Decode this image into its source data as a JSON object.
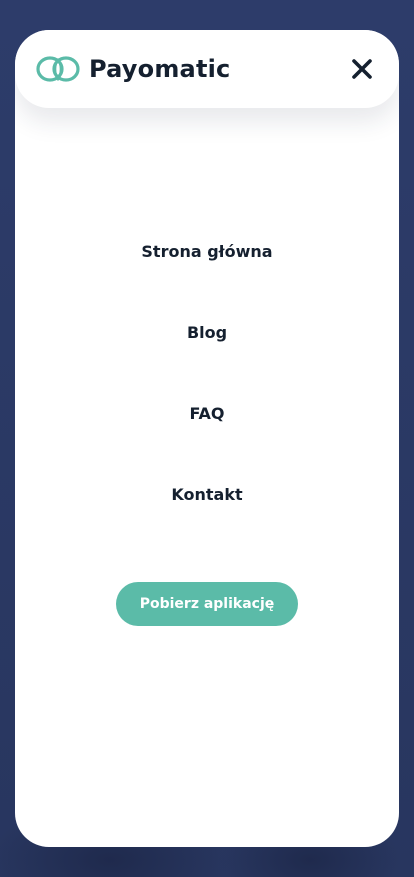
{
  "brand": {
    "name": "Payomatic",
    "accent_color": "#5bbba8",
    "text_color": "#15202f",
    "logo_icon": "interlocking-hearts-logo-icon"
  },
  "header": {
    "close_icon": "close-icon"
  },
  "nav": {
    "items": [
      {
        "label": "Strona główna"
      },
      {
        "label": "Blog"
      },
      {
        "label": "FAQ"
      },
      {
        "label": "Kontakt"
      }
    ]
  },
  "cta": {
    "label": "Pobierz aplikację"
  }
}
